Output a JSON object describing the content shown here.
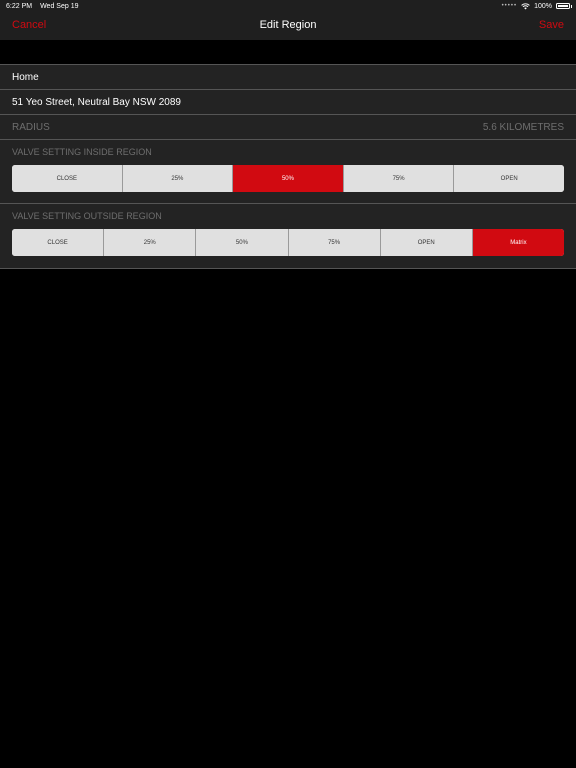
{
  "status_bar": {
    "time": "6:22 PM",
    "date": "Wed Sep 19",
    "signal": "•••••",
    "wifi_icon": "wifi-icon",
    "battery": "100%"
  },
  "nav": {
    "cancel": "Cancel",
    "title": "Edit Region",
    "save": "Save"
  },
  "form": {
    "name": "Home",
    "address": "51 Yeo Street, Neutral Bay NSW 2089",
    "radius_label": "RADIUS",
    "radius_value": "5.6 KILOMETRES"
  },
  "inside": {
    "label": "VALVE SETTING INSIDE REGION",
    "options": [
      "CLOSE",
      "25%",
      "50%",
      "75%",
      "OPEN"
    ],
    "selected": "50%"
  },
  "outside": {
    "label": "VALVE SETTING OUTSIDE REGION",
    "options": [
      "CLOSE",
      "25%",
      "50%",
      "75%",
      "OPEN",
      "Matrix"
    ],
    "selected": "Matrix"
  },
  "colors": {
    "accent": "#d10a11",
    "background": "#000000",
    "panel": "#232323",
    "bar": "#1f1f1f"
  }
}
